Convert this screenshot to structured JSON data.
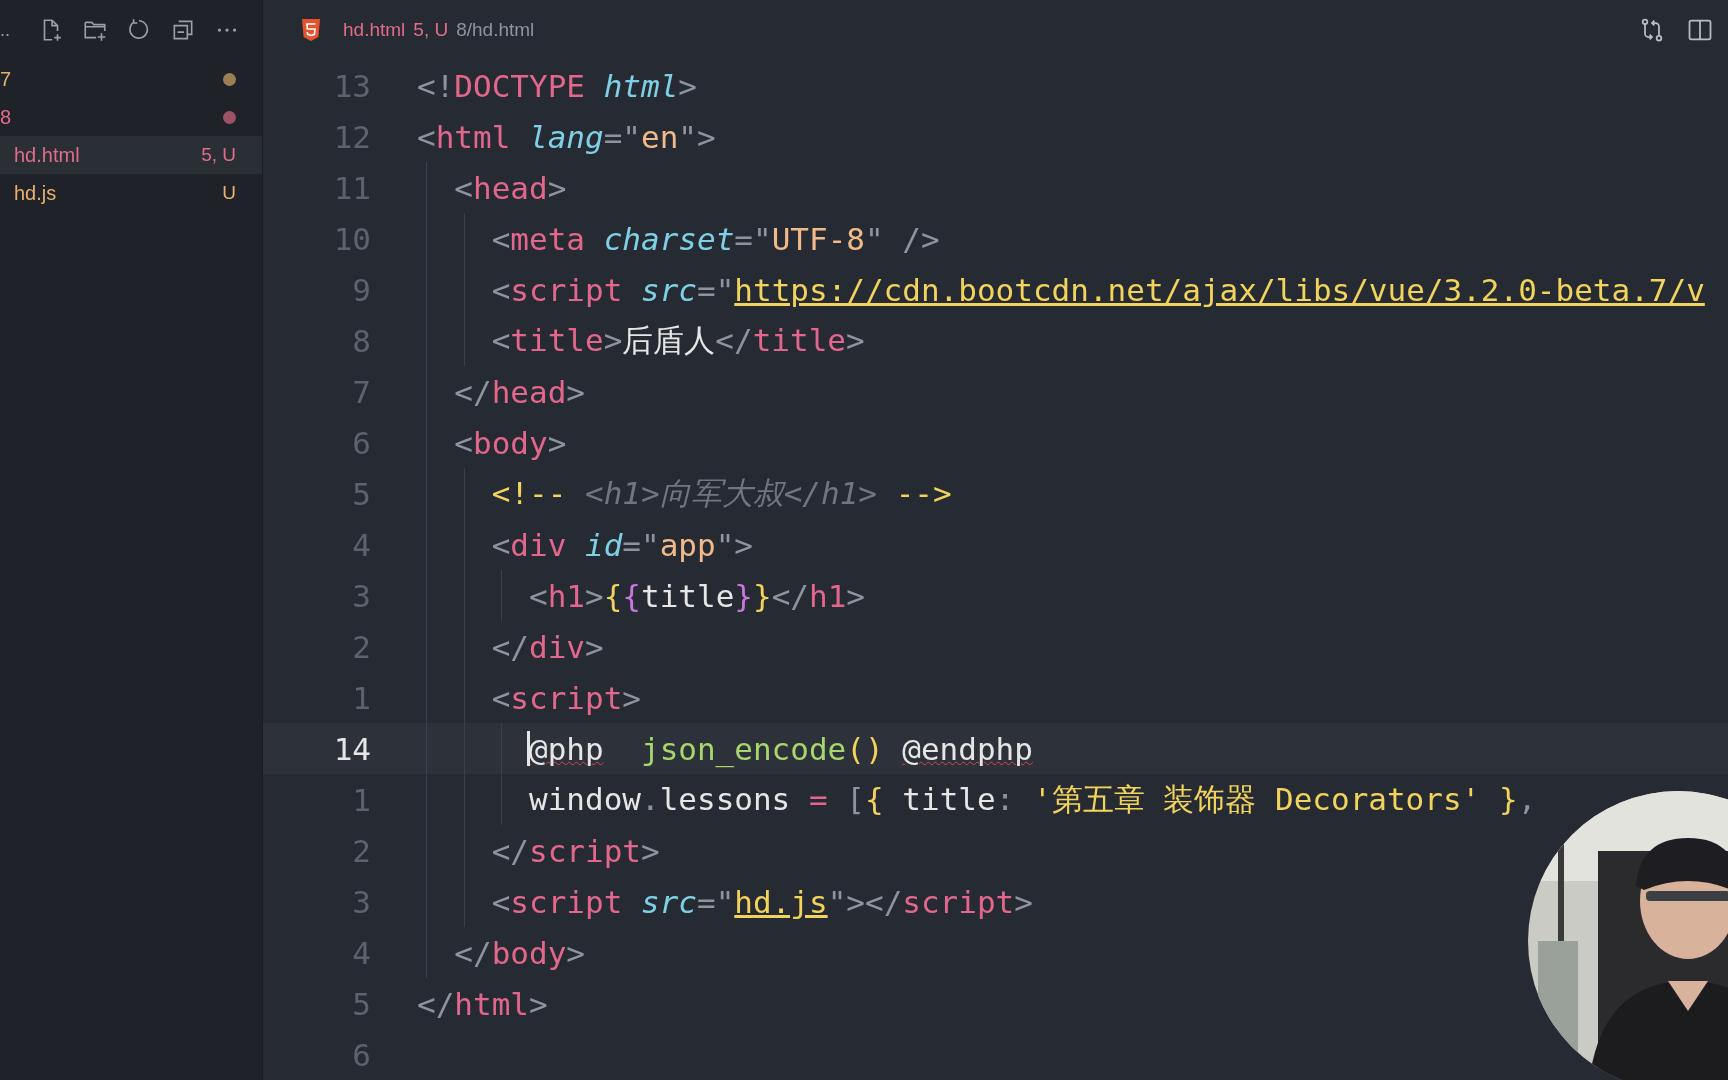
{
  "sidebar": {
    "title": "..",
    "files": [
      {
        "name": "7",
        "dot": true,
        "color": "#e0b070",
        "selected": false
      },
      {
        "name": "8",
        "dot": true,
        "color": "#e06c8a",
        "selected": false
      },
      {
        "name": "hd.html",
        "dot": false,
        "status": "5, U",
        "color": "#e06c8a",
        "selected": true
      },
      {
        "name": "hd.js",
        "dot": false,
        "status": "U",
        "color": "#e8b06a",
        "selected": false
      }
    ]
  },
  "tabs": [
    {
      "kind": "html",
      "label": "hd.html",
      "status": "5, U",
      "path": "8/hd.html",
      "selected": true
    }
  ],
  "editor": {
    "lines": [
      {
        "number": "13",
        "current": false,
        "tokens": [
          {
            "kind": "punct",
            "text": "<!"
          },
          {
            "kind": "tag",
            "text": "DOCTYPE"
          },
          {
            "kind": "attr",
            "text": " html"
          },
          {
            "kind": "punct",
            "text": ">"
          }
        ]
      },
      {
        "number": "12",
        "current": false,
        "tokens": [
          {
            "kind": "punct",
            "text": "<"
          },
          {
            "kind": "tag",
            "text": "html"
          },
          {
            "kind": "attr",
            "text": " lang"
          },
          {
            "kind": "punct",
            "text": "=\""
          },
          {
            "kind": "string",
            "text": "en"
          },
          {
            "kind": "punct",
            "text": "\">"
          }
        ]
      },
      {
        "number": "11",
        "current": false,
        "tokens": [
          {
            "kind": "punct",
            "text": "  <"
          },
          {
            "kind": "tag",
            "text": "head"
          },
          {
            "kind": "punct",
            "text": ">"
          }
        ]
      },
      {
        "number": "10",
        "current": false,
        "tokens": [
          {
            "kind": "punct",
            "text": "    <"
          },
          {
            "kind": "tag",
            "text": "meta"
          },
          {
            "kind": "attr",
            "text": " charset"
          },
          {
            "kind": "punct",
            "text": "=\""
          },
          {
            "kind": "string",
            "text": "UTF-8"
          },
          {
            "kind": "punct",
            "text": "\" />"
          }
        ]
      },
      {
        "number": "9",
        "current": false,
        "tokens": [
          {
            "kind": "punct",
            "text": "    <"
          },
          {
            "kind": "tag",
            "text": "script"
          },
          {
            "kind": "attr",
            "text": " src"
          },
          {
            "kind": "punct",
            "text": "=\""
          },
          {
            "kind": "link",
            "text": "https://cdn.bootcdn.net/ajax/libs/vue/3.2.0-beta.7/v"
          }
        ]
      },
      {
        "number": "8",
        "current": false,
        "tokens": [
          {
            "kind": "punct",
            "text": "    <"
          },
          {
            "kind": "tag",
            "text": "title"
          },
          {
            "kind": "punct",
            "text": ">"
          },
          {
            "kind": "plain",
            "text": "后盾人"
          },
          {
            "kind": "punct",
            "text": "</"
          },
          {
            "kind": "tag",
            "text": "title"
          },
          {
            "kind": "punct",
            "text": ">"
          }
        ]
      },
      {
        "number": "7",
        "current": false,
        "tokens": [
          {
            "kind": "punct",
            "text": "  </"
          },
          {
            "kind": "tag",
            "text": "head"
          },
          {
            "kind": "punct",
            "text": ">"
          }
        ]
      },
      {
        "number": "6",
        "current": false,
        "tokens": [
          {
            "kind": "punct",
            "text": "  <"
          },
          {
            "kind": "tag",
            "text": "body"
          },
          {
            "kind": "punct",
            "text": ">"
          }
        ]
      },
      {
        "number": "5",
        "current": false,
        "tokens": [
          {
            "kind": "comment-mark",
            "text": "    <!--"
          },
          {
            "kind": "comment",
            "text": " <h1>向军大叔</h1> "
          },
          {
            "kind": "comment-mark",
            "text": "-->"
          }
        ]
      },
      {
        "number": "4",
        "current": false,
        "tokens": [
          {
            "kind": "punct",
            "text": "    <"
          },
          {
            "kind": "tag",
            "text": "div"
          },
          {
            "kind": "attr",
            "text": " id"
          },
          {
            "kind": "punct",
            "text": "=\""
          },
          {
            "kind": "string",
            "text": "app"
          },
          {
            "kind": "punct",
            "text": "\">"
          }
        ]
      },
      {
        "number": "3",
        "current": false,
        "tokens": [
          {
            "kind": "punct",
            "text": "      <"
          },
          {
            "kind": "tag",
            "text": "h1"
          },
          {
            "kind": "punct",
            "text": ">"
          },
          {
            "kind": "brace",
            "text": "{"
          },
          {
            "kind": "brace2",
            "text": "{"
          },
          {
            "kind": "plain",
            "text": "title"
          },
          {
            "kind": "brace2",
            "text": "}"
          },
          {
            "kind": "brace",
            "text": "}"
          },
          {
            "kind": "punct",
            "text": "</"
          },
          {
            "kind": "tag",
            "text": "h1"
          },
          {
            "kind": "punct",
            "text": ">"
          }
        ]
      },
      {
        "number": "2",
        "current": false,
        "tokens": [
          {
            "kind": "punct",
            "text": "    </"
          },
          {
            "kind": "tag",
            "text": "div"
          },
          {
            "kind": "punct",
            "text": ">"
          }
        ]
      },
      {
        "number": "1",
        "current": false,
        "tokens": [
          {
            "kind": "punct",
            "text": "    <"
          },
          {
            "kind": "tag",
            "text": "script"
          },
          {
            "kind": "punct",
            "text": ">"
          }
        ]
      },
      {
        "number": "14",
        "current": true,
        "tokens": [
          {
            "kind": "error",
            "text": "      @php"
          },
          {
            "kind": "func",
            "text": "  json_encode"
          },
          {
            "kind": "brace",
            "text": "()"
          },
          {
            "kind": "error",
            "text": " @endphp"
          }
        ]
      },
      {
        "number": "1",
        "current": false,
        "tokens": [
          {
            "kind": "plain",
            "text": "      window"
          },
          {
            "kind": "punct",
            "text": "."
          },
          {
            "kind": "plain",
            "text": "lessons"
          },
          {
            "kind": "tag",
            "text": " ="
          },
          {
            "kind": "punct",
            "text": " ["
          },
          {
            "kind": "brace",
            "text": "{"
          },
          {
            "kind": "plain",
            "text": " title"
          },
          {
            "kind": "punct",
            "text": ": "
          },
          {
            "kind": "yellow",
            "text": "'第五章 装饰器 Decorators'"
          },
          {
            "kind": "brace",
            "text": " }"
          },
          {
            "kind": "punct",
            "text": ","
          }
        ]
      },
      {
        "number": "2",
        "current": false,
        "tokens": [
          {
            "kind": "punct",
            "text": "    </"
          },
          {
            "kind": "tag",
            "text": "script"
          },
          {
            "kind": "punct",
            "text": ">"
          }
        ]
      },
      {
        "number": "3",
        "current": false,
        "tokens": [
          {
            "kind": "punct",
            "text": "    <"
          },
          {
            "kind": "tag",
            "text": "script"
          },
          {
            "kind": "attr",
            "text": " src"
          },
          {
            "kind": "punct",
            "text": "=\""
          },
          {
            "kind": "link",
            "text": "hd.js"
          },
          {
            "kind": "punct",
            "text": "\"></"
          },
          {
            "kind": "tag",
            "text": "script"
          },
          {
            "kind": "punct",
            "text": ">"
          }
        ]
      },
      {
        "number": "4",
        "current": false,
        "tokens": [
          {
            "kind": "punct",
            "text": "  </"
          },
          {
            "kind": "tag",
            "text": "body"
          },
          {
            "kind": "punct",
            "text": ">"
          }
        ]
      },
      {
        "number": "5",
        "current": false,
        "tokens": [
          {
            "kind": "punct",
            "text": "</"
          },
          {
            "kind": "tag",
            "text": "html"
          },
          {
            "kind": "punct",
            "text": ">"
          }
        ]
      },
      {
        "number": "6",
        "current": false
      }
    ]
  }
}
